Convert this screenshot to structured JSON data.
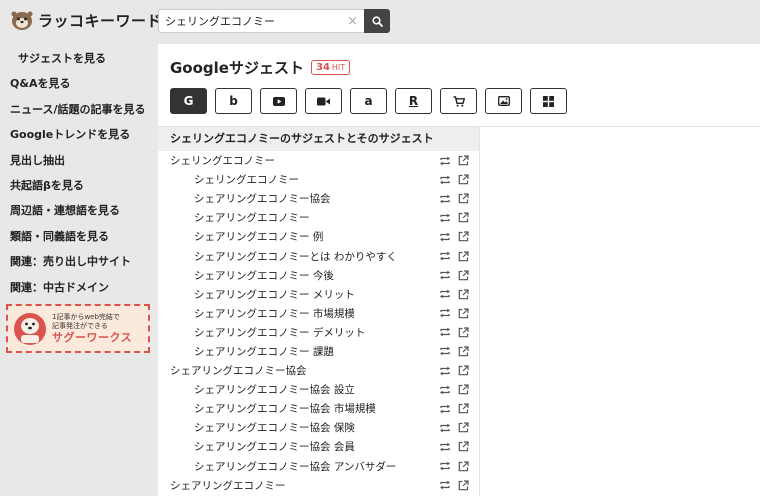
{
  "header": {
    "logo_text": "ラッコキーワード",
    "search": {
      "value": "シェリングエコノミー",
      "clear_symbol": "×"
    }
  },
  "sidebar": {
    "items": [
      {
        "label": "サジェストを見る"
      },
      {
        "label": "Q&Aを見る"
      },
      {
        "label": "ニュース/話題の記事を見る"
      },
      {
        "label": "Googleトレンドを見る"
      },
      {
        "label": "見出し抽出"
      },
      {
        "label": "共起語βを見る"
      },
      {
        "label": "周辺語・連想語を見る"
      },
      {
        "label": "類語・同義語を見る"
      },
      {
        "label": "関連：売り出し中サイト"
      },
      {
        "label": "関連：中古ドメイン"
      }
    ],
    "ad": {
      "line1": "1記事からweb完結で",
      "line2": "記事発注ができる",
      "brand": "サグーワークス"
    }
  },
  "main": {
    "title": "Googleサジェスト",
    "hit_count": "34",
    "hit_label": "HIT",
    "engines": [
      {
        "name": "google",
        "glyph": "G"
      },
      {
        "name": "bing",
        "glyph": "b"
      },
      {
        "name": "youtube",
        "glyph": "▶"
      },
      {
        "name": "video",
        "glyph": "■"
      },
      {
        "name": "amazon",
        "glyph": "a"
      },
      {
        "name": "rakuten",
        "glyph": "R"
      },
      {
        "name": "shopping",
        "glyph": "🛒"
      },
      {
        "name": "image",
        "glyph": "▣"
      },
      {
        "name": "appstore",
        "glyph": "⊞"
      }
    ],
    "list_header": "シェリングエコノミーのサジェストとそのサジェスト",
    "rows": [
      {
        "text": "シェリングエコノミー",
        "level": 0
      },
      {
        "text": "シェリングエコノミー",
        "level": 1
      },
      {
        "text": "シェアリングエコノミー協会",
        "level": 1
      },
      {
        "text": "シェアリングエコノミー",
        "level": 1
      },
      {
        "text": "シェアリングエコノミー 例",
        "level": 1
      },
      {
        "text": "シェアリングエコノミーとは わかりやすく",
        "level": 1
      },
      {
        "text": "シェアリングエコノミー 今後",
        "level": 1
      },
      {
        "text": "シェアリングエコノミー メリット",
        "level": 1
      },
      {
        "text": "シェアリングエコノミー 市場規模",
        "level": 1
      },
      {
        "text": "シェアリングエコノミー デメリット",
        "level": 1
      },
      {
        "text": "シェアリングエコノミー 課題",
        "level": 1
      },
      {
        "text": "シェアリングエコノミー協会",
        "level": 0
      },
      {
        "text": "シェアリングエコノミー協会 設立",
        "level": 1
      },
      {
        "text": "シェアリングエコノミー協会 市場規模",
        "level": 1
      },
      {
        "text": "シェアリングエコノミー協会 保険",
        "level": 1
      },
      {
        "text": "シェアリングエコノミー協会 会員",
        "level": 1
      },
      {
        "text": "シェアリングエコノミー協会 アンバサダー",
        "level": 1
      },
      {
        "text": "シェアリングエコノミー",
        "level": 0
      }
    ]
  }
}
